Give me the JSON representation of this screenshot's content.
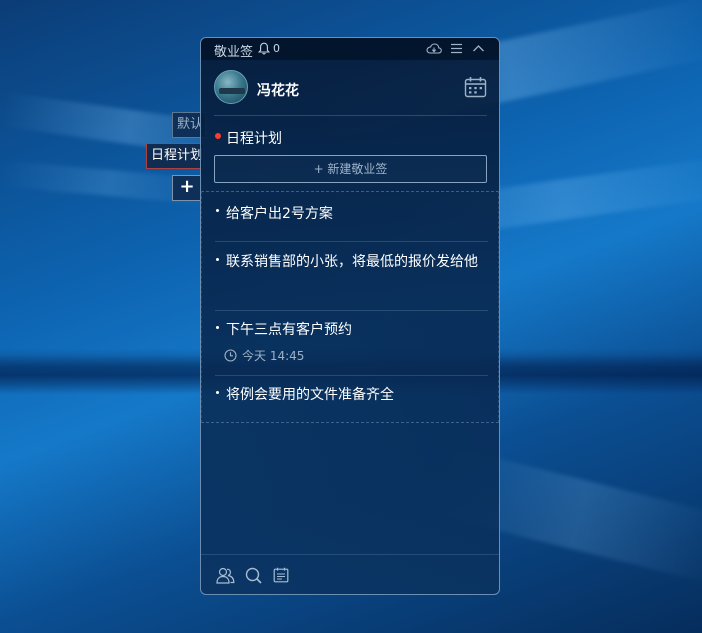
{
  "side_tabs": {
    "default_label": "默认",
    "schedule_label": "日程计划",
    "add_label": "+"
  },
  "titlebar": {
    "app_name": "敬业签",
    "reminder_count": "0"
  },
  "user": {
    "name": "冯花花"
  },
  "category": {
    "title": "日程计划",
    "dot_color": "#ff3b30"
  },
  "new_note_label": "+ 新建敬业签",
  "notes": [
    {
      "text": "给客户出2号方案"
    },
    {
      "text": "联系销售部的小张，将最低的报价发给他"
    },
    {
      "text": "下午三点有客户预约",
      "time": "今天 14:45"
    },
    {
      "text": "将例会要用的文件准备齐全"
    }
  ],
  "icons": {
    "bell": "bell-icon",
    "cloud": "cloud-sync-icon",
    "menu": "menu-icon",
    "collapse": "chevron-up-icon",
    "calendar": "calendar-icon",
    "contacts": "contacts-icon",
    "search": "search-icon",
    "notes": "notes-icon",
    "clock": "clock-icon"
  }
}
